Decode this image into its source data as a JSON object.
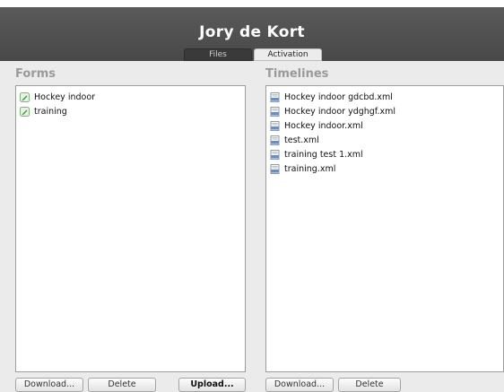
{
  "app": {
    "title": "Jory de Kort"
  },
  "tabs": [
    {
      "label": "Files",
      "active": true
    },
    {
      "label": "Activation",
      "active": false
    }
  ],
  "forms": {
    "title": "Forms",
    "items": [
      {
        "label": "Hockey indoor",
        "icon": "form-icon"
      },
      {
        "label": "training",
        "icon": "form-icon"
      }
    ],
    "buttons": {
      "download": "Download...",
      "delete": "Delete",
      "upload": "Upload..."
    }
  },
  "timelines": {
    "title": "Timelines",
    "items": [
      {
        "label": "Hockey indoor gdcbd.xml",
        "icon": "xml-file-icon"
      },
      {
        "label": "Hockey indoor ydghgf.xml",
        "icon": "xml-file-icon"
      },
      {
        "label": "Hockey indoor.xml",
        "icon": "xml-file-icon"
      },
      {
        "label": "test.xml",
        "icon": "xml-file-icon"
      },
      {
        "label": "training test 1.xml",
        "icon": "xml-file-icon"
      },
      {
        "label": "training.xml",
        "icon": "xml-file-icon"
      }
    ],
    "buttons": {
      "download": "Download...",
      "delete": "Delete"
    }
  },
  "colors": {
    "titlebar": "#4f4f4f",
    "active_tab": "#3a3a3a",
    "section_title": "#9a9a9a",
    "form_icon": "#3e9a3e"
  }
}
